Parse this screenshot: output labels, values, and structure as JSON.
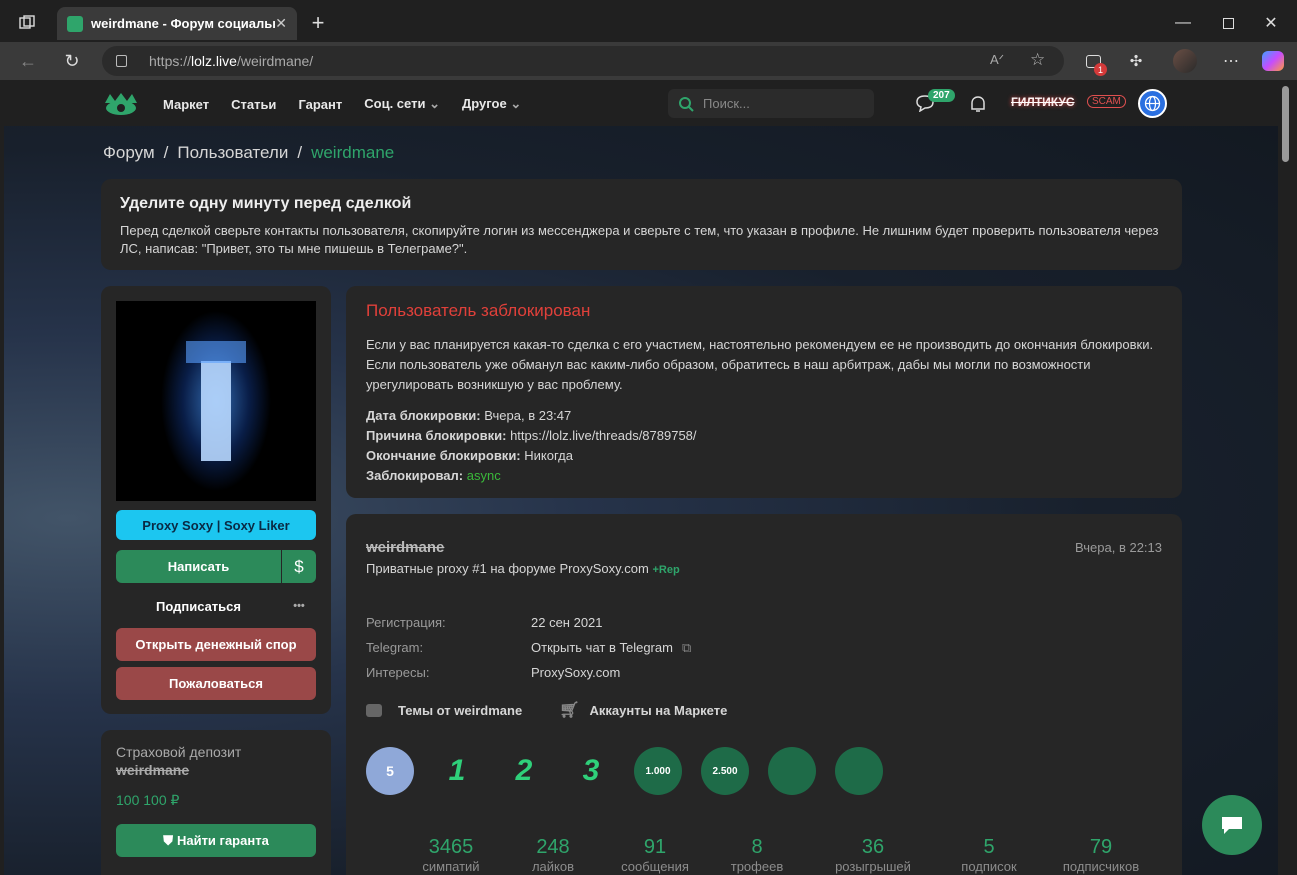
{
  "browser": {
    "tab_title": "weirdmane - Форум социальной",
    "url_prefix": "https://",
    "url_domain": "lolz.live",
    "url_path": "/weirdmane/",
    "ext_badge": "1"
  },
  "site": {
    "nav": [
      "Маркет",
      "Статьи",
      "Гарант",
      "Соц. сети",
      "Другое"
    ],
    "search_placeholder": "Поиск...",
    "msg_count": "207",
    "username": "ГИЛТИКУС",
    "user_tag": "SCAM"
  },
  "breadcrumb": {
    "forum": "Форум",
    "users": "Пользователи",
    "current": "weirdmane",
    "sep": "/"
  },
  "notice": {
    "title": "Уделите одну минуту перед сделкой",
    "text": "Перед сделкой сверьте контакты пользователя, скопируйте логин из мессенджера и сверьте с тем, что указан в профиле. Не лишним будет проверить пользователя через ЛС, написав: \"Привет, это ты мне пишешь в Телеграме?\"."
  },
  "sidebar": {
    "banner": "Proxy Soxy | Soxy Liker",
    "write": "Написать",
    "dollar": "$",
    "subscribe": "Подписаться",
    "more": "•••",
    "dispute": "Открыть денежный спор",
    "report": "Пожаловаться",
    "deposit_title": "Страховой депозит",
    "deposit_user": "weirdmane",
    "deposit_amount": "100 100 ₽",
    "guarantor": "Найти гаранта"
  },
  "ban": {
    "title": "Пользователь заблокирован",
    "text": "Если у вас планируется какая-то сделка с его участием, настоятельно рекомендуем ее не производить до окончания блокировки. Если пользователь уже обманул вас каким-либо образом, обратитесь в наш арбитраж, дабы мы могли по возможности урегулировать возникшую у вас проблему.",
    "date_label": "Дата блокировки:",
    "date": "Вчера, в 23:47",
    "reason_label": "Причина блокировки:",
    "reason": "https://lolz.live/threads/8789758/",
    "end_label": "Окончание блокировки:",
    "end": "Никогда",
    "by_label": "Заблокировал:",
    "by": "async"
  },
  "profile": {
    "name": "weirdmane",
    "time": "Вчера, в 22:13",
    "status": "Приватные proxy #1 на форуме ProxySoxy.com",
    "rep": "+Rep",
    "fields": [
      {
        "label": "Регистрация:",
        "value": "22 сен 2021"
      },
      {
        "label": "Telegram:",
        "value": "Открыть чат в Telegram"
      },
      {
        "label": "Интересы:",
        "value": "ProxySoxy.com"
      }
    ],
    "topics_link": "Темы от weirdmane",
    "market_link": "Аккаунты на Маркете",
    "trophies": [
      "5",
      "1",
      "2",
      "3",
      "1.000",
      "2.500",
      "",
      ""
    ],
    "stats": [
      {
        "n": "3465",
        "t": "симпатий"
      },
      {
        "n": "248",
        "t": "лайков"
      },
      {
        "n": "91",
        "t": "сообщения"
      },
      {
        "n": "8",
        "t": "трофеев"
      },
      {
        "n": "36",
        "t": "розыгрышей"
      },
      {
        "n": "5",
        "t": "подписок"
      },
      {
        "n": "79",
        "t": "подписчиков"
      }
    ]
  },
  "colors": {
    "accent": "#2fa56b",
    "danger": "#e0403a",
    "banner": "#1cc6f0",
    "report": "#9a4848"
  }
}
